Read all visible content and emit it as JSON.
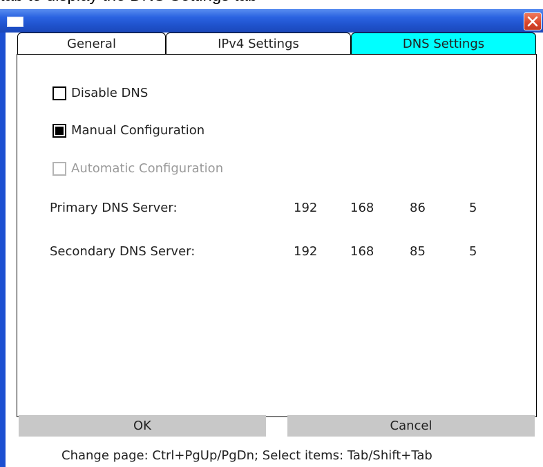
{
  "page_caption": "tab to display the DNS Settings tab",
  "window": {
    "title": "",
    "icon": "window-icon",
    "close_icon": "close-x-icon"
  },
  "tabs": [
    {
      "label": "General",
      "active": false
    },
    {
      "label": "IPv4 Settings",
      "active": false
    },
    {
      "label": "DNS Settings",
      "active": true
    }
  ],
  "dns": {
    "disable_dns": {
      "label": "Disable DNS",
      "checked": false,
      "enabled": true
    },
    "manual_config": {
      "label": "Manual Configuration",
      "checked": true,
      "enabled": true
    },
    "auto_config": {
      "label": "Automatic Configuration",
      "checked": false,
      "enabled": false
    },
    "primary": {
      "label": "Primary DNS Server:",
      "octets": [
        "192",
        "168",
        "86",
        "5"
      ]
    },
    "secondary": {
      "label": "Secondary DNS Server:",
      "octets": [
        "192",
        "168",
        "85",
        "5"
      ]
    }
  },
  "buttons": {
    "ok": "OK",
    "cancel": "Cancel"
  },
  "hint": "Change page: Ctrl+PgUp/PgDn; Select items: Tab/Shift+Tab",
  "colors": {
    "titlebar": "#2b63e1",
    "active_tab": "#00ffff",
    "button_bg": "#c8c8c8",
    "close_button": "#d9452a"
  }
}
